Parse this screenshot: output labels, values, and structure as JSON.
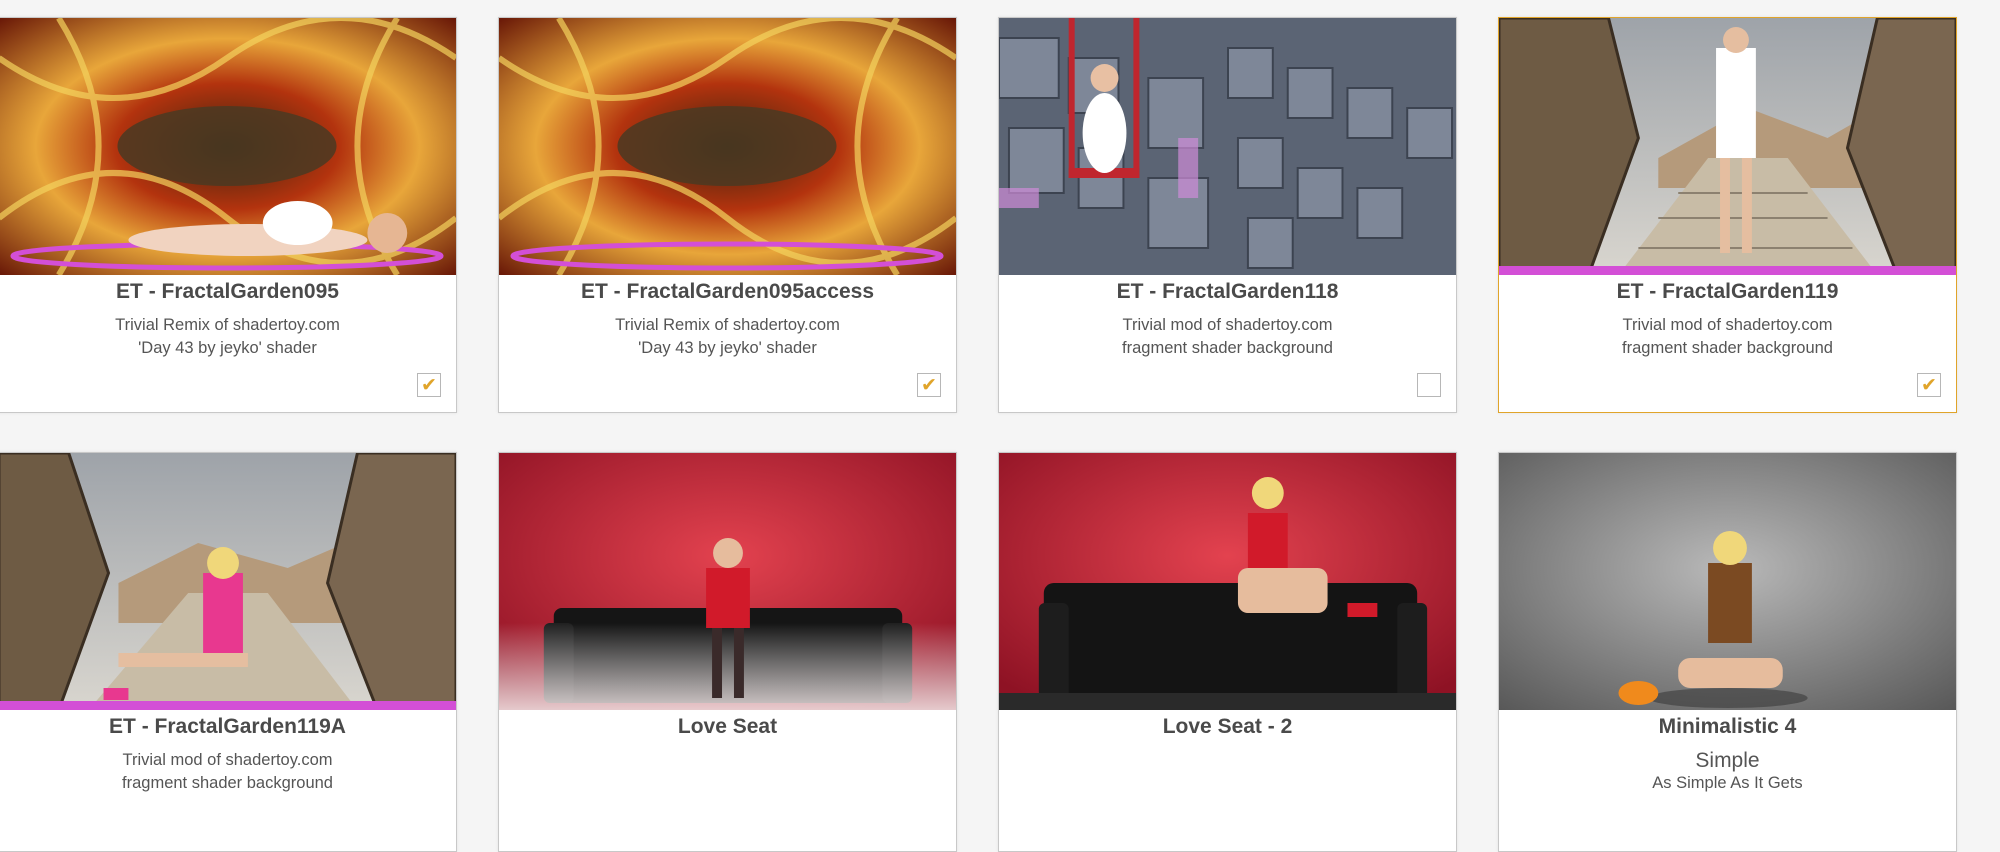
{
  "cards": [
    {
      "title": "ET - FractalGarden095",
      "desc1": "Trivial Remix of shadertoy.com",
      "desc2": "'Day 43 by jeyko' shader",
      "checked": true,
      "check_mark": "✔"
    },
    {
      "title": "ET - FractalGarden095access",
      "desc1": "Trivial Remix of shadertoy.com",
      "desc2": "'Day 43 by jeyko' shader",
      "checked": true,
      "check_mark": "✔"
    },
    {
      "title": "ET - FractalGarden118",
      "desc1": "Trivial mod of shadertoy.com",
      "desc2": "fragment shader background",
      "checked": false,
      "check_mark": ""
    },
    {
      "title": "ET - FractalGarden119",
      "desc1": "Trivial mod of shadertoy.com",
      "desc2": "fragment shader background",
      "checked": true,
      "check_mark": "✔"
    },
    {
      "title": "ET - FractalGarden119A",
      "desc1": "Trivial mod of shadertoy.com",
      "desc2": "fragment shader background"
    },
    {
      "title": "Love Seat",
      "desc1": "",
      "desc2": ""
    },
    {
      "title": "Love Seat - 2",
      "desc1": "",
      "desc2": ""
    },
    {
      "title": "Minimalistic 4",
      "desc1": "Simple",
      "desc2": "As Simple As It Gets"
    }
  ],
  "colors": {
    "accent": "#e0a42a",
    "selected_border": "#e0a42a",
    "neon_ring": "#d34fd6"
  }
}
